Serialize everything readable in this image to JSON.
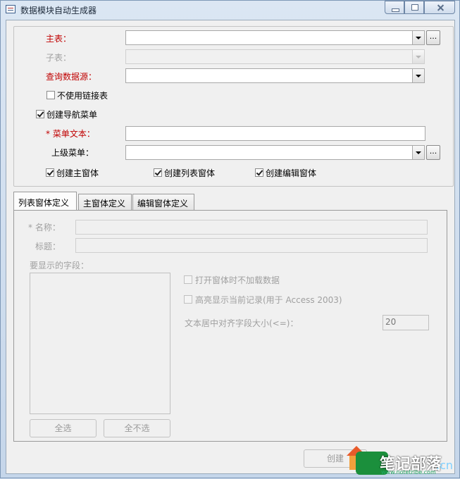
{
  "window": {
    "title": "数据模块自动生成器"
  },
  "form": {
    "main_table_label": "主表：",
    "sub_table_label": "子表：",
    "query_source_label": "查询数据源：",
    "no_link_table_label": "不使用链接表",
    "create_nav_menu_label": "创建导航菜单",
    "menu_text_label": "* 菜单文本：",
    "parent_menu_label": "上级菜单：",
    "create_main_form_label": "创建主窗体",
    "create_list_form_label": "创建列表窗体",
    "create_edit_form_label": "创建编辑窗体",
    "browse_button_label": "...",
    "checkboxes": {
      "no_link_table": false,
      "create_nav_menu": true,
      "create_main_form": true,
      "create_list_form": true,
      "create_edit_form": true
    }
  },
  "tabs": [
    {
      "label": "列表窗体定义",
      "active": true
    },
    {
      "label": "主窗体定义",
      "active": false
    },
    {
      "label": "编辑窗体定义",
      "active": false
    }
  ],
  "list_tab": {
    "name_label": "* 名称：",
    "caption_label": "标题：",
    "fields_label": "要显示的字段：",
    "no_load_on_open_label": "打开窗体时不加载数据",
    "highlight_current_label": "高亮显示当前记录(用于 Access 2003)",
    "center_align_label": "文本居中对齐字段大小(<=)：",
    "center_align_value": "20",
    "select_all_label": "全选",
    "select_none_label": "全不选"
  },
  "footer": {
    "create_button_label": "创建"
  },
  "watermark": {
    "text": "笔记部落",
    "url": "www.notetribe.com",
    "side": ".cn"
  },
  "colors": {
    "required_label": "#c00000",
    "disabled_text": "#a0a0a0",
    "title_bar": "#c9d9ec"
  }
}
